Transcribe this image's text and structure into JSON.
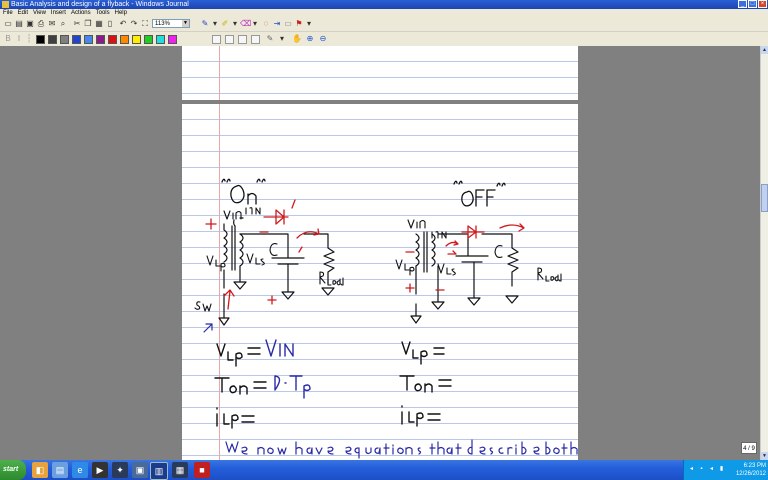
{
  "window": {
    "title": "Basic Analysis and design of a flyback - Windows Journal",
    "controls": [
      "_",
      "□",
      "×"
    ]
  },
  "menu": [
    "File",
    "Edit",
    "View",
    "Insert",
    "Actions",
    "Tools",
    "Help"
  ],
  "toolbar": {
    "zoom": "113%"
  },
  "palette": [
    "#000000",
    "#404040",
    "#808080",
    "#2244cc",
    "#4488ee",
    "#8b1a8b",
    "#dd1111",
    "#ff8800",
    "#ffee00",
    "#22cc22",
    "#22dddd",
    "#ee22ee"
  ],
  "page_indicator": "4 / 9",
  "taskbar": {
    "start": "start",
    "time": "6:23 PM",
    "date": "12/26/2012"
  }
}
